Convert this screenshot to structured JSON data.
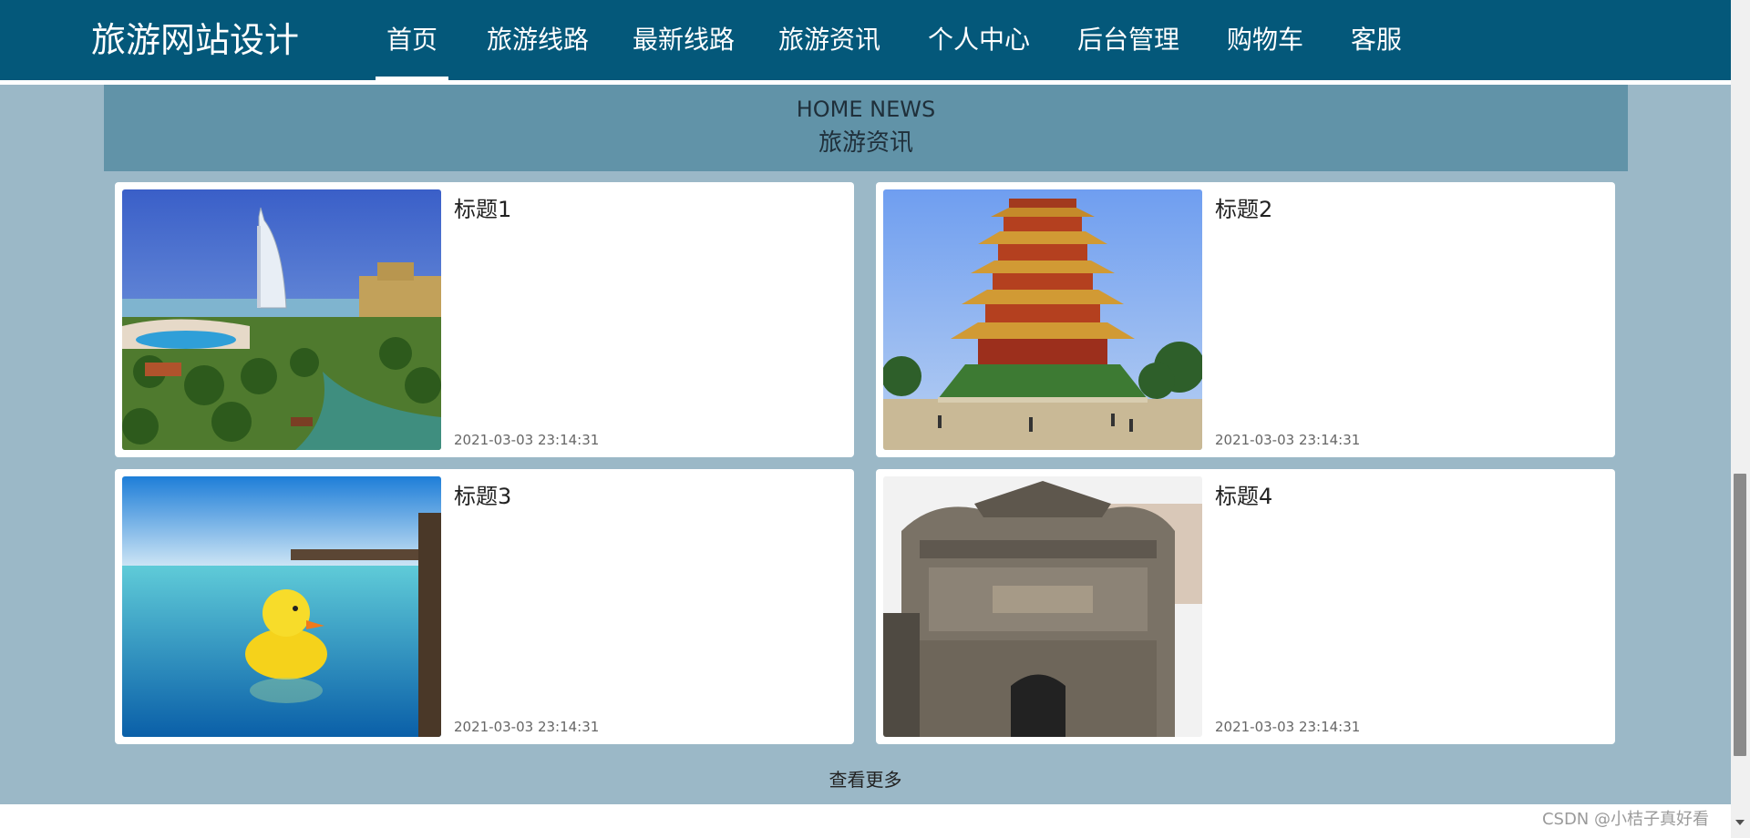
{
  "header": {
    "logo": "旅游网站设计",
    "nav": [
      {
        "label": "首页",
        "active": true
      },
      {
        "label": "旅游线路"
      },
      {
        "label": "最新线路"
      },
      {
        "label": "旅游资讯"
      },
      {
        "label": "个人中心"
      },
      {
        "label": "后台管理"
      },
      {
        "label": "购物车"
      },
      {
        "label": "客服"
      }
    ]
  },
  "section": {
    "title_en": "HOME NEWS",
    "title_cn": "旅游资讯"
  },
  "news": [
    {
      "title": "标题1",
      "time": "2021-03-03 23:14:31",
      "image": "burj-al-arab-resort"
    },
    {
      "title": "标题2",
      "time": "2021-03-03 23:14:31",
      "image": "yellow-crane-tower"
    },
    {
      "title": "标题3",
      "time": "2021-03-03 23:14:31",
      "image": "rubber-duck-pool"
    },
    {
      "title": "标题4",
      "time": "2021-03-03 23:14:31",
      "image": "ancient-stone-gate"
    }
  ],
  "more_label": "查看更多",
  "watermark": "CSDN @小桔子真好看",
  "colors": {
    "header": "#04587a",
    "section_head": "#6193a8",
    "background": "#9bb8c7"
  }
}
